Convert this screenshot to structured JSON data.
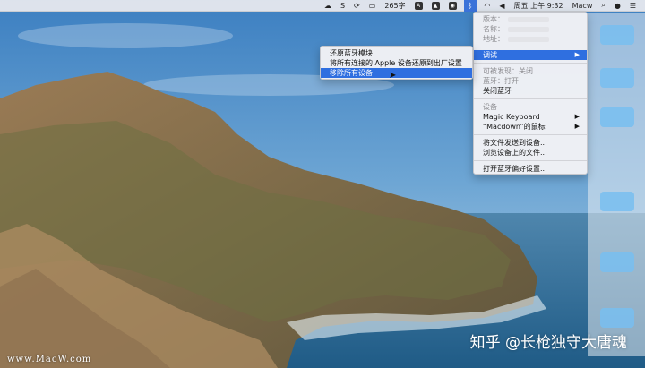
{
  "menubar": {
    "items": [
      "S",
      "265字",
      "周五 上午 9:32",
      "Macw"
    ]
  },
  "bluetooth_menu": {
    "info": [
      {
        "label": "版本："
      },
      {
        "label": "名称："
      },
      {
        "label": "地址："
      }
    ],
    "debug": "调试",
    "discoverable": "可被发现：关闭",
    "bluetooth_status": "蓝牙：打开",
    "turn_off": "关闭蓝牙",
    "devices_header": "设备",
    "devices": [
      "Magic Keyboard",
      "“Macdown”的鼠标"
    ],
    "send_file": "将文件发送到设备...",
    "browse_files": "浏览设备上的文件...",
    "open_prefs": "打开蓝牙偏好设置..."
  },
  "debug_submenu": {
    "items": [
      "还原蓝牙模块",
      "将所有连接的 Apple 设备还原到出厂设置",
      "移除所有设备"
    ],
    "highlighted": "移除所有设备"
  },
  "watermarks": {
    "site": "www.MacW.com",
    "author": "知乎 @长枪独守大唐魂"
  }
}
